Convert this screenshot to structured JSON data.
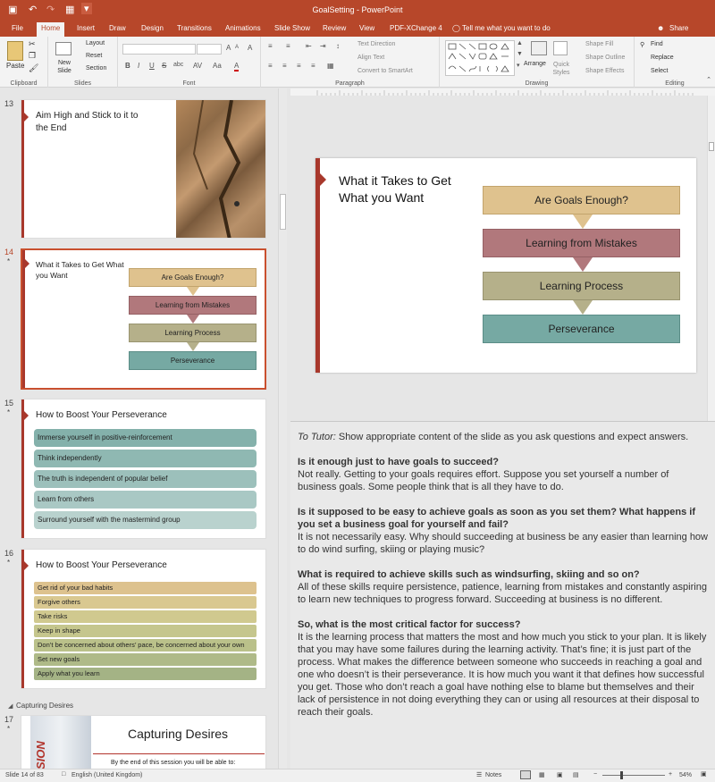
{
  "window": {
    "title": "GoalSetting - PowerPoint"
  },
  "qat": {
    "save": "▣",
    "undo": "↶",
    "redo": "↷",
    "present": "▦",
    "more": "▾"
  },
  "tabs": [
    {
      "label": "File"
    },
    {
      "label": "Home"
    },
    {
      "label": "Insert"
    },
    {
      "label": "Draw"
    },
    {
      "label": "Design"
    },
    {
      "label": "Transitions"
    },
    {
      "label": "Animations"
    },
    {
      "label": "Slide Show"
    },
    {
      "label": "Review"
    },
    {
      "label": "View"
    },
    {
      "label": "PDF-XChange 4"
    }
  ],
  "tellme": "Tell me what you want to do",
  "share": "Share",
  "ribbon": {
    "clipboard": {
      "label": "Clipboard",
      "paste": "Paste"
    },
    "slides": {
      "label": "Slides",
      "new_slide": "New Slide",
      "layout": "Layout",
      "reset": "Reset",
      "section": "Section"
    },
    "font": {
      "label": "Font",
      "bold": "B",
      "italic": "I",
      "underline": "U",
      "strike": "S",
      "shadow": "abc",
      "size_up": "A",
      "size_down": "A",
      "clear": "A",
      "spacing": "AV",
      "case": "Aa",
      "color": "A"
    },
    "paragraph": {
      "label": "Paragraph",
      "text_direction": "Text Direction",
      "align_text": "Align Text",
      "smartart": "Convert to SmartArt"
    },
    "drawing": {
      "label": "Drawing",
      "arrange": "Arrange",
      "quick_styles": "Quick Styles",
      "shape_fill": "Shape Fill",
      "shape_outline": "Shape Outline",
      "shape_effects": "Shape Effects"
    },
    "editing": {
      "label": "Editing",
      "find": "Find",
      "replace": "Replace",
      "select": "Select"
    }
  },
  "thumbs": {
    "s13": {
      "num": "13",
      "title": "Aim High and Stick to it to the End"
    },
    "s14": {
      "num": "14",
      "star": "*",
      "title": "What it Takes to Get What you Want"
    },
    "s15": {
      "num": "15",
      "star": "*",
      "title": "How to Boost Your Perseverance",
      "items": [
        "Immerse yourself in positive-reinforcement",
        "Think independently",
        "The truth is independent of popular belief",
        "Learn from others",
        "Surround yourself with the mastermind group"
      ]
    },
    "s16": {
      "num": "16",
      "star": "*",
      "title": "How to Boost Your Perseverance",
      "items": [
        "Get rid of your bad habits",
        "Forgive others",
        "Take risks",
        "Keep in shape",
        "Don’t be concerned about others’ pace, be concerned about your own",
        "Set new goals",
        "Apply what you learn"
      ]
    },
    "section": "Capturing Desires",
    "s17": {
      "num": "17",
      "star": "*",
      "title": "Capturing Desires",
      "sub": "By the end of this session you will be able to:",
      "vision": "SION"
    }
  },
  "flow": [
    "Are Goals Enough?",
    "Learning from Mistakes",
    "Learning Process",
    "Perseverance"
  ],
  "main_slide": {
    "title": "What it Takes to Get What you Want"
  },
  "notes": {
    "intro_label": "To Tutor:",
    "intro": " Show appropriate content of the slide as you ask questions and expect answers.",
    "qa": [
      {
        "q": "Is it enough just to have goals to succeed?",
        "a": "Not really. Getting to your goals requires effort. Suppose you set yourself a number of business goals. Some people think that is all they have to do."
      },
      {
        "q": "Is it supposed to be easy to achieve goals as soon as you set them? What happens if you set a business goal for yourself and fail?",
        "a": "It is not necessarily easy. Why should succeeding at business be any easier than learning how to do wind surfing, skiing or playing music?"
      },
      {
        "q": "What is required to achieve skills such as windsurfing, skiing and so on?",
        "a": "All of these skills require persistence, patience, learning from mistakes and constantly aspiring to learn new techniques to progress forward. Succeeding at business is no different."
      },
      {
        "q": "So, what is the most critical factor for success?",
        "a": "It is the learning process that matters the most and how much you stick to your plan. It is likely that you may have some failures during the learning activity. That’s fine; it is just part of the process. What makes the difference between someone who succeeds in reaching a goal and one who doesn’t is their perseverance. It is how much you want it that defines how successful you get. Those who don’t reach a goal have nothing else to blame but themselves and their lack of persistence in not doing everything they can or using all resources at their disposal to reach their goals."
      }
    ]
  },
  "status": {
    "slide": "Slide 14 of 83",
    "language": "English (United Kingdom)",
    "notes": "Notes",
    "zoom": "54%"
  },
  "colors": {
    "accent": "#b7472a",
    "tan": "#dfc28e",
    "mauve": "#b1787c",
    "olive": "#b5b08a",
    "teal": "#76a9a3"
  }
}
